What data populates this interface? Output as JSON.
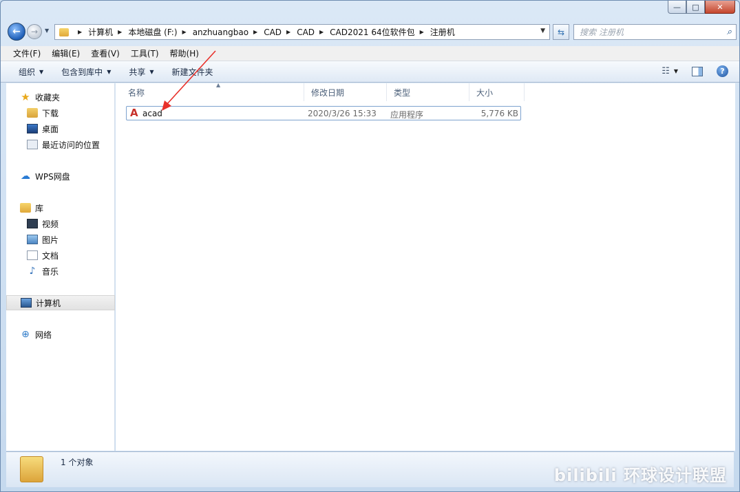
{
  "window": {
    "caption": {
      "minimize": "—",
      "maximize": "□",
      "close": "✕"
    }
  },
  "address": {
    "back_icon": "←",
    "forward_icon": "→",
    "crumbs": [
      "计算机",
      "本地磁盘 (F:)",
      "anzhuangbao",
      "CAD",
      "CAD",
      "CAD2021 64位软件包",
      "注册机"
    ],
    "refresh_icon": "⇆",
    "search_placeholder": "搜索 注册机"
  },
  "menu": [
    "文件(F)",
    "编辑(E)",
    "查看(V)",
    "工具(T)",
    "帮助(H)"
  ],
  "commands": {
    "organize": "组织",
    "include_library": "包含到库中",
    "share": "共享",
    "new_folder": "新建文件夹"
  },
  "nav": {
    "favorites": "收藏夹",
    "downloads": "下载",
    "desktop": "桌面",
    "recent": "最近访问的位置",
    "wps": "WPS网盘",
    "libraries": "库",
    "videos": "视频",
    "pictures": "图片",
    "documents": "文档",
    "music": "音乐",
    "computer": "计算机",
    "network": "网络"
  },
  "columns": {
    "name": "名称",
    "modified": "修改日期",
    "type": "类型",
    "size": "大小"
  },
  "files": [
    {
      "name": "acad",
      "modified": "2020/3/26 15:33",
      "type": "应用程序",
      "size": "5,776 KB",
      "icon": "autocad-icon"
    }
  ],
  "status": {
    "count": "1 个对象"
  },
  "watermark": "bilibili 环球设计联盟",
  "colors": {
    "accent": "#3b78c0",
    "annotation": "#e8302a"
  }
}
